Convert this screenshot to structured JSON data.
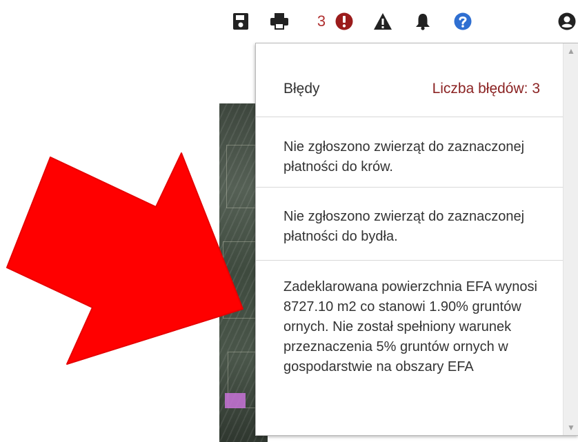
{
  "toolbar": {
    "icons": [
      "save-icon",
      "print-icon",
      "error-icon",
      "warning-icon",
      "bell-icon",
      "help-icon",
      "user-icon"
    ],
    "error_count": "3",
    "colors": {
      "error": "#9b1c1c",
      "help": "#2f6fd1",
      "dark": "#222222"
    }
  },
  "errors_panel": {
    "title": "Błędy",
    "count_label": "Liczba błędów: 3",
    "items": [
      {
        "text": "Nie zgłoszono zwierząt do zaznaczonej płatności do krów."
      },
      {
        "text": "Nie zgłoszono zwierząt do zaznaczonej płatności do bydła."
      },
      {
        "text": "Zadeklarowana powierzchnia EFA wynosi 8727.10 m2 co stanowi 1.90% gruntów ornych. Nie został spełniony warunek przeznaczenia 5% gruntów ornych w gospodarstwie na obszary EFA"
      }
    ]
  },
  "annotation": {
    "arrow_color": "#ff0000"
  }
}
